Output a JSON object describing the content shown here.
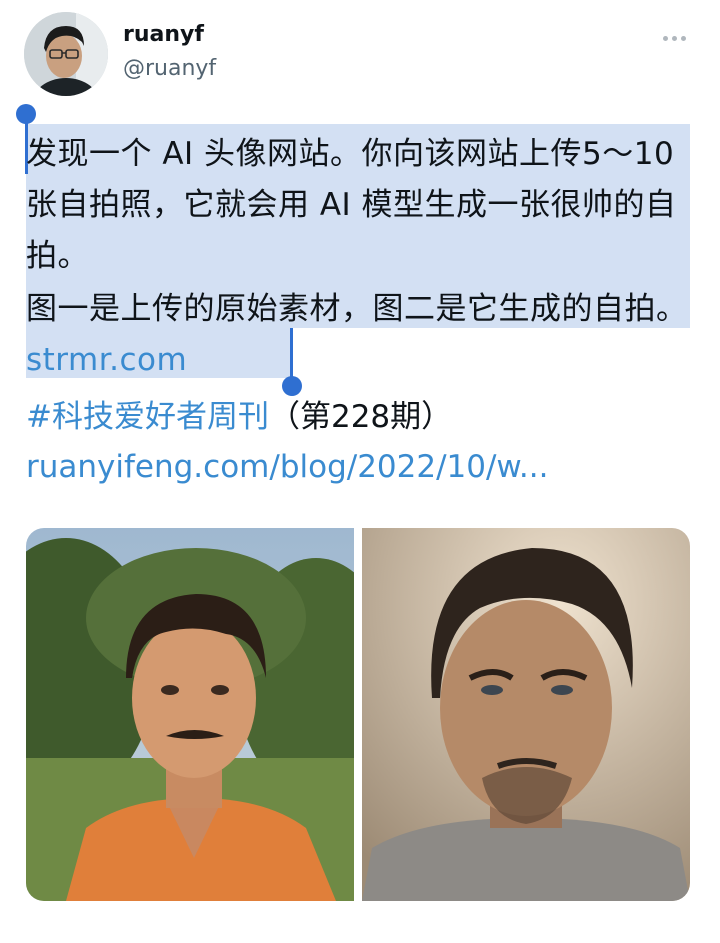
{
  "tweet": {
    "author_name": "ruanyf",
    "author_handle": "@ruanyf",
    "para1": "发现一个 AI 头像网站。你向该网站上传5～10张自拍照，它就会用 AI 模型生成一张很帅的自拍。",
    "para2_text": "图一是上传的原始素材，图二是它生成的自拍。",
    "para2_link": "strmr.com",
    "hashtag": "#科技爱好者周刊",
    "issue": "（第228期）",
    "url": "ruanyifeng.com/blog/2022/10/w..."
  },
  "icons": {
    "more": "more-dots-icon"
  },
  "colors": {
    "link": "#3a8bd0",
    "selection": "#d3e0f3",
    "selection_handle": "#2f6fd1"
  }
}
